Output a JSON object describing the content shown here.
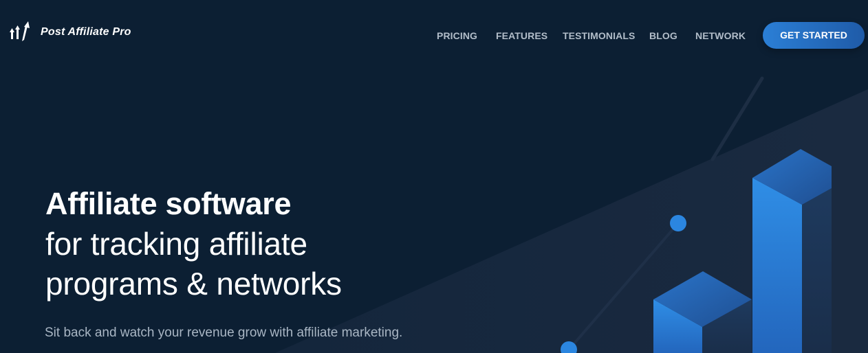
{
  "brand": {
    "name": "Post Affiliate Pro",
    "logo_icon": "rising-arrows-icon"
  },
  "nav": {
    "items": [
      {
        "label": "PRICING"
      },
      {
        "label": "FEATURES"
      },
      {
        "label": "TESTIMONIALS"
      },
      {
        "label": "BLOG"
      },
      {
        "label": "NETWORK"
      }
    ],
    "cta_label": "GET STARTED"
  },
  "hero": {
    "title": "Affiliate software",
    "subtitle_line1": "for tracking affiliate",
    "subtitle_line2": "programs & networks",
    "description": "Sit back and watch your revenue grow with affiliate marketing."
  },
  "colors": {
    "background": "#0c1f33",
    "accent": "#2b7fd6",
    "nav_text": "#b2bdc9",
    "muted_text": "#a9b6c4"
  }
}
